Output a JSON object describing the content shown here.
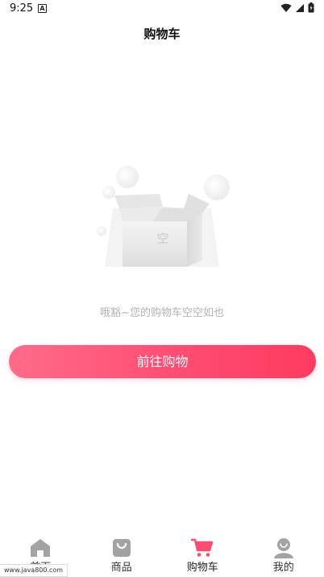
{
  "status_bar": {
    "time": "9:25",
    "notification_icon": "A"
  },
  "header": {
    "title": "购物车"
  },
  "empty_state": {
    "box_glyph": "空",
    "message": "哦豁~您的购物车空空如也",
    "button_label": "前往购物"
  },
  "bottom_nav": {
    "items": [
      {
        "label": "首页",
        "icon": "home-icon"
      },
      {
        "label": "商品",
        "icon": "shopping-bag-icon"
      },
      {
        "label": "购物车",
        "icon": "cart-icon",
        "active": true
      },
      {
        "label": "我的",
        "icon": "user-icon"
      }
    ]
  },
  "watermark": "www.java800.com",
  "colors": {
    "accent": "#ff4d72",
    "nav_icon": "#9a9a9a",
    "empty_text": "#b3b3b3"
  }
}
